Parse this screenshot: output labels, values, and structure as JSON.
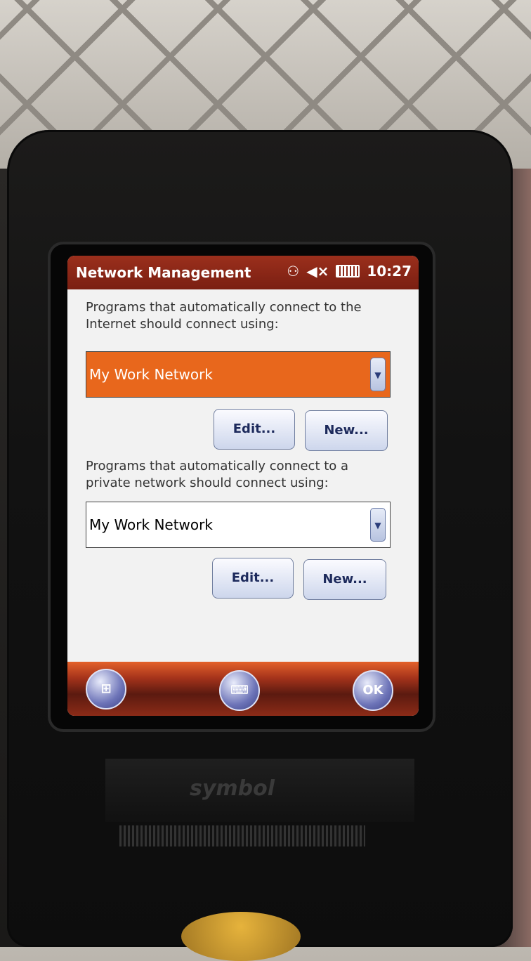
{
  "titlebar": {
    "title": "Network Management",
    "time": "10:27",
    "icons": [
      "connectivity-icon",
      "volume-muted-icon",
      "battery-icon"
    ]
  },
  "internet": {
    "prompt": "Programs that automatically connect to the Internet should connect using:",
    "selected": "My Work Network",
    "edit_label": "Edit...",
    "new_label": "New..."
  },
  "private": {
    "prompt": "Programs that automatically connect to a private network should connect using:",
    "selected": "My Work Network",
    "edit_label": "Edit...",
    "new_label": "New..."
  },
  "taskbar": {
    "start_icon": "windows-start-icon",
    "keyboard_icon": "keyboard-icon",
    "ok_label": "OK"
  },
  "device": {
    "brand": "symbol"
  },
  "colors": {
    "titlebar": "#9b2f1c",
    "selected_dropdown": "#e8671c",
    "button_text": "#1d2a5c"
  }
}
